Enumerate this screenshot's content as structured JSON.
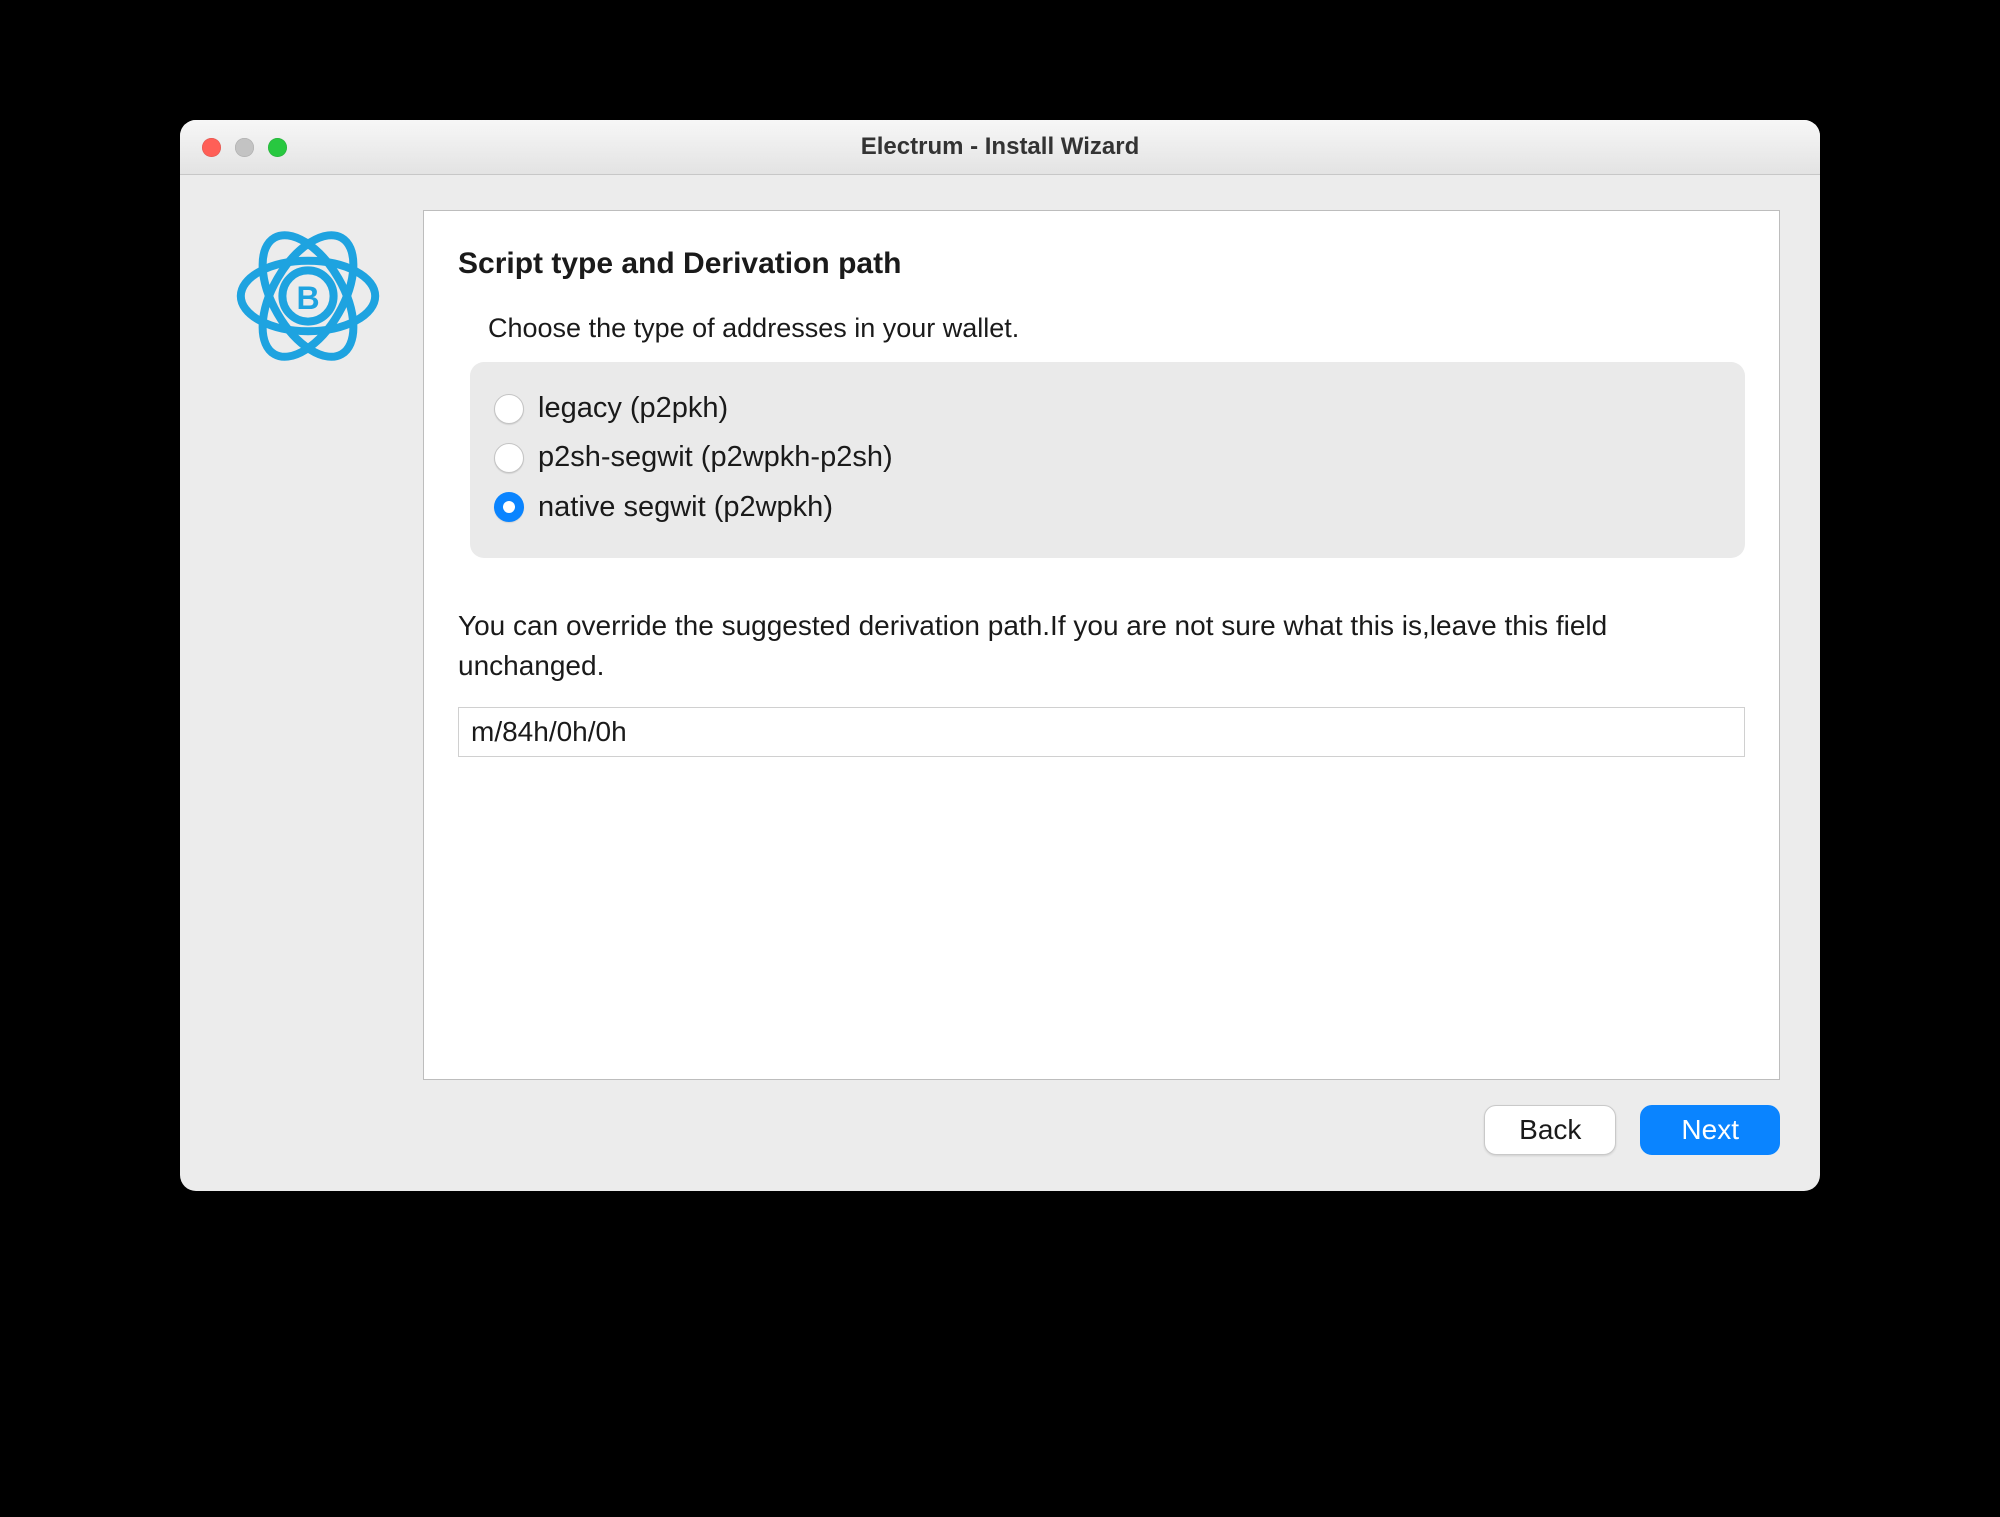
{
  "window": {
    "title": "Electrum  -  Install Wizard"
  },
  "panel": {
    "heading": "Script type and Derivation path",
    "intro": "Choose the type of addresses in your wallet.",
    "options": {
      "legacy": {
        "label": "legacy (p2pkh)",
        "selected": false
      },
      "p2sh": {
        "label": "p2sh-segwit (p2wpkh-p2sh)",
        "selected": false
      },
      "native": {
        "label": "native segwit (p2wpkh)",
        "selected": true
      }
    },
    "override_text": "You can override the suggested derivation path.If you are not sure what this is,leave this field unchanged.",
    "path_value": "m/84h/0h/0h"
  },
  "buttons": {
    "back": "Back",
    "next": "Next"
  }
}
